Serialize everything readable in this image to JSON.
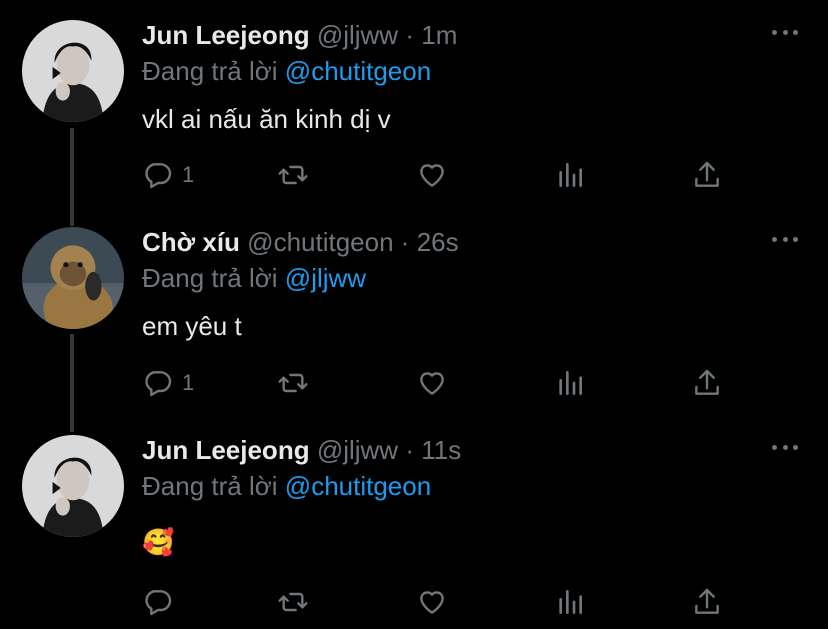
{
  "tweets": [
    {
      "name": "Jun Leejeong",
      "handle": "@jljww",
      "dot": "·",
      "time": "1m",
      "reply_prefix": "Đang trả lời",
      "reply_to": "@chutitgeon",
      "text": "vkl ai nấu ăn kinh dị v",
      "reply_count": "1",
      "avatar": "person-photo"
    },
    {
      "name": "Chờ xíu",
      "handle": "@chutitgeon",
      "dot": "·",
      "time": "26s",
      "reply_prefix": "Đang trả lời",
      "reply_to": "@jljww",
      "text": "em yêu t",
      "reply_count": "1",
      "avatar": "monkey-photo"
    },
    {
      "name": "Jun Leejeong",
      "handle": "@jljww",
      "dot": "·",
      "time": "11s",
      "reply_prefix": "Đang trả lời",
      "reply_to": "@chutitgeon",
      "text": "🥰",
      "reply_count": "",
      "avatar": "person-photo"
    }
  ],
  "icons": [
    "reply-icon",
    "retweet-icon",
    "like-icon",
    "analytics-icon",
    "share-icon",
    "more-icon"
  ],
  "colors": {
    "background": "#000000",
    "text": "#e7e9ea",
    "muted": "#71767b",
    "accent": "#1d9bf0"
  }
}
